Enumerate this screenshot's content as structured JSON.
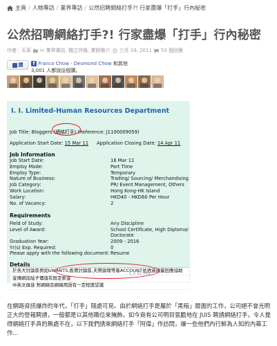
{
  "breadcrumb": {
    "items": [
      "主頁",
      "人物專訪",
      "業界專訪",
      "公然招聘網絡打手?! 行家盡爆「打手」行內秘密"
    ],
    "separator": "/"
  },
  "article": {
    "title": "公然招聘網絡打手?! 行家盡爆「打手」行內秘密",
    "meta": {
      "author": "作者：天草",
      "category": "in 業界專訪, 獨立評論, 業餘推介",
      "date": "三月 19, 2011",
      "comments": "53 個回應"
    }
  },
  "facebook": {
    "like_label": "讚",
    "friend1": "Franco Chow",
    "separator": "·",
    "friend2": "Desmond Chow",
    "others": "和其他",
    "count_text": "3,001 人都說這個讚。"
  },
  "faces": [
    "#c9a07d",
    "#7a5a3e",
    "#3d3d3d",
    "#b89a6b",
    "#d4c1a1",
    "#6f6f6f",
    "#e0c09a",
    "#a07050",
    "#555555",
    "#c08a5a",
    "#8a6a4a",
    "#dab89a"
  ],
  "doc": {
    "title": "I. I. Limited-Human Resources Department",
    "job_title_label": "Job Title:",
    "job_title_value": "Bloggers (網絡打手) (Reference: J1100009059)",
    "start_label": "Application Start Date:",
    "start_value": "15 Mar 11",
    "close_label": "Application Closing Date:",
    "close_value": "14 Apr 11",
    "job_info_heading": "Job Information",
    "fields": [
      {
        "label": "Job Start Date:",
        "value": "16 Mar 11"
      },
      {
        "label": "Employ Mode:",
        "value": "Part Time"
      },
      {
        "label": "Employ Type:",
        "value": "Temporary"
      },
      {
        "label": "Nature of Business:",
        "value": "Trading/ Sourcing/ Merchandising"
      },
      {
        "label": "Job Category:",
        "value": "PR/ Event Management, Others"
      },
      {
        "label": "Work Location:",
        "value": "Hong Kong-HK Island"
      },
      {
        "label": "Salary:",
        "value": "HKD40 - HKD60 Per Hour"
      },
      {
        "label": "No. of Vacancy:",
        "value": "2"
      }
    ],
    "req_heading": "Requirements",
    "reqs": [
      {
        "label": "Field of Study:",
        "value": "Any Discipline"
      },
      {
        "label": "Level of Award:",
        "value": "School Certificate, High Diploma/ Associate Degree/ Doctorate"
      },
      {
        "label": "Graduation Year:",
        "value": "2009 - 2016"
      },
      {
        "label": "Yr(s) Exp. Required:",
        "value": "0"
      },
      {
        "label": "Please apply with the following document:",
        "value": "Resume"
      }
    ],
    "level_value_line2": "Doctorate",
    "details_heading": "Details",
    "details_lines": [
      "於各大討論區例如UWANTS,香港討論區,夫際論壇等客ACCOUNT並透過適量回應協助",
      "宣傳網誌貼子價值有既定薪金",
      "中英文俱佳 對網絡及網絡用語有一定程度認識"
    ],
    "watermark": "CFH.HK"
  },
  "body_text": "在網路資訊爆炸的年代，「打手」隨處可見。由於網絡打手是屬於「黑暗」層面的工作，公司絕不會光明正大的登報聘請，一般都是以其他職位來掩飾。如今竟有公司明目張膽地在 JUIS 聘請網絡打手，令人覺得網絡打手真的無處不在，以下我們請來網絡打手「阿偉」作訪問，爆一些他們內行鮮為人知的內幕工作..."
}
